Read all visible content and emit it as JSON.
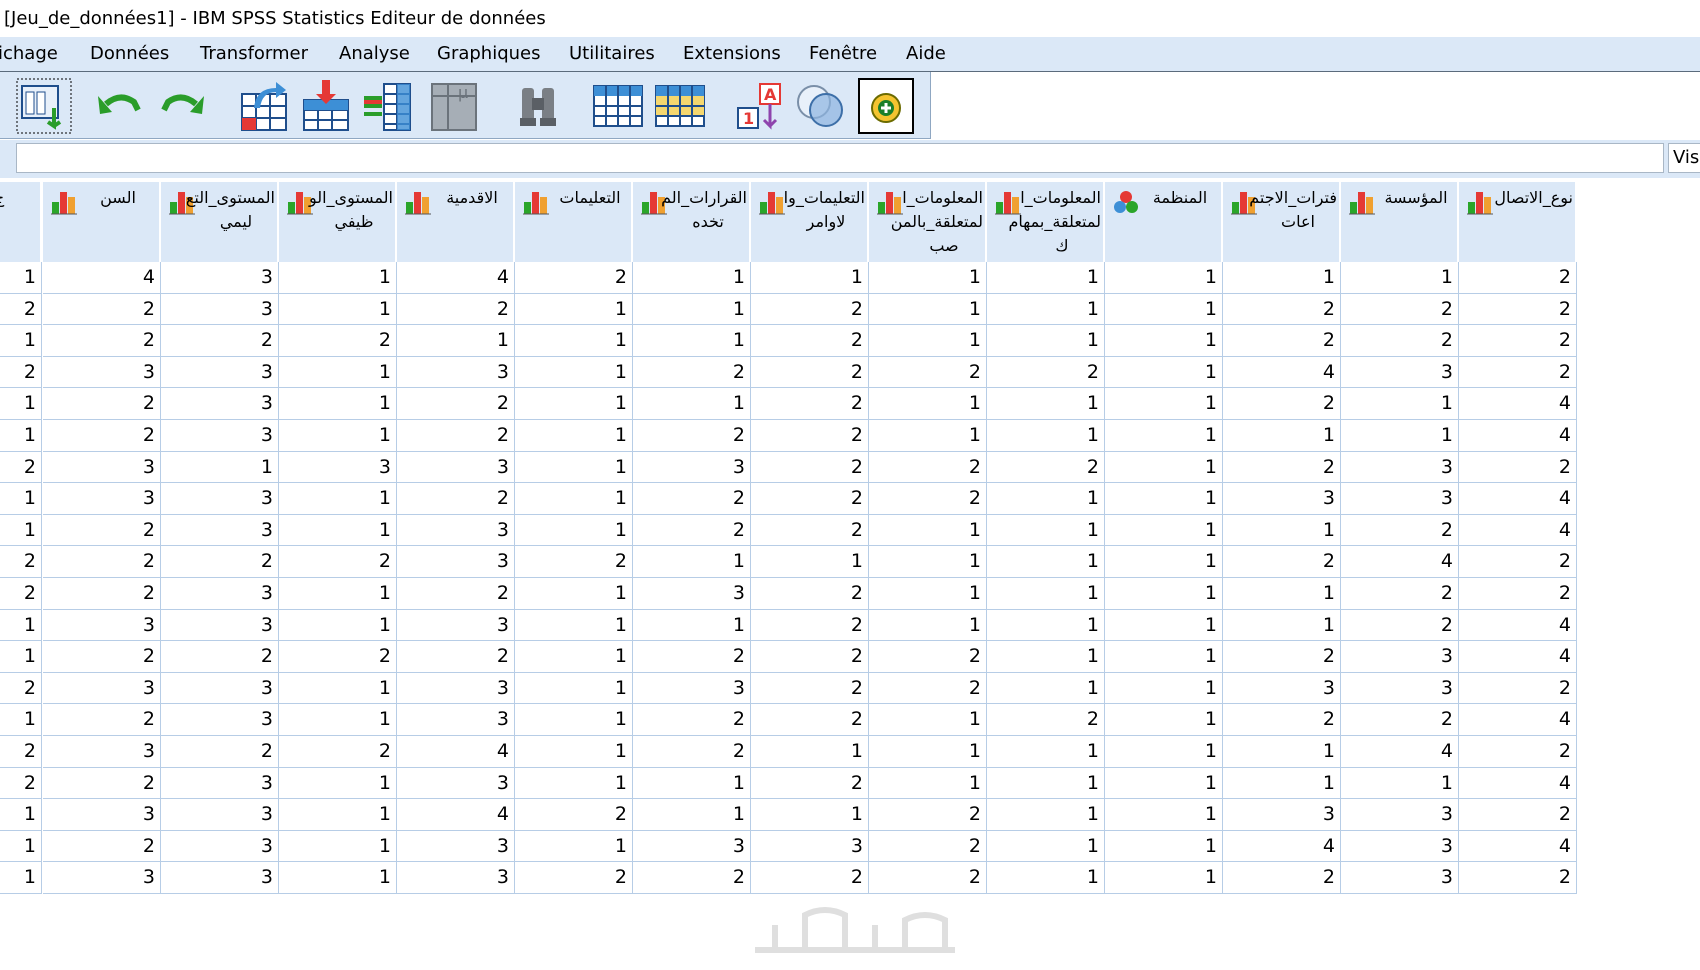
{
  "window": {
    "title": "[Jeu_de_données1] - IBM SPSS Statistics Editeur de données"
  },
  "menu": {
    "items": [
      {
        "id": "view",
        "label": "ichage"
      },
      {
        "id": "data",
        "label": "Données"
      },
      {
        "id": "transform",
        "label": "Transformer"
      },
      {
        "id": "analyze",
        "label": "Analyse"
      },
      {
        "id": "graphs",
        "label": "Graphiques"
      },
      {
        "id": "utilities",
        "label": "Utilitaires"
      },
      {
        "id": "extensions",
        "label": "Extensions"
      },
      {
        "id": "window",
        "label": "Fenêtre"
      },
      {
        "id": "help",
        "label": "Aide"
      }
    ]
  },
  "toolbar": {
    "buttons": [
      {
        "name": "recall-dialog-icon"
      },
      {
        "name": "undo-icon"
      },
      {
        "name": "redo-icon"
      },
      {
        "name": "goto-case-icon"
      },
      {
        "name": "insert-cases-icon"
      },
      {
        "name": "insert-variable-icon"
      },
      {
        "name": "variables-icon"
      },
      {
        "name": "find-icon"
      },
      {
        "name": "split-file-icon"
      },
      {
        "name": "select-cases-icon"
      },
      {
        "name": "value-labels-icon"
      },
      {
        "name": "use-sets-icon"
      },
      {
        "name": "spell-check-icon"
      }
    ]
  },
  "editbar": {
    "cell_value": "",
    "visible_label": "Vis"
  },
  "grid": {
    "columns": [
      {
        "name": "ج",
        "line2": "",
        "icon": "bar"
      },
      {
        "name": "السن",
        "line2": "",
        "icon": "bar"
      },
      {
        "name": "المستوى_التع",
        "line2": "ليمي",
        "icon": "bar"
      },
      {
        "name": "المستوى_الو",
        "line2": "ظيفي",
        "icon": "bar"
      },
      {
        "name": "الاقدمية",
        "line2": "",
        "icon": "bar"
      },
      {
        "name": "التعليمات",
        "line2": "",
        "icon": "bar"
      },
      {
        "name": "القرارات_الم",
        "line2": "تخده",
        "icon": "bar"
      },
      {
        "name": "التعليمات_وا",
        "line2": "لاوامر",
        "icon": "bar"
      },
      {
        "name": "المعلومات_ا",
        "line2": "لمتعلقة_بالمن",
        "line3": "صب",
        "icon": "bar"
      },
      {
        "name": "المعلومات_ا",
        "line2": "لمتعلقة_بمهام",
        "line3": "ك",
        "icon": "bar"
      },
      {
        "name": "المنظمة",
        "line2": "",
        "icon": "nominal"
      },
      {
        "name": "فترات_الاجتم",
        "line2": "اعات",
        "icon": "bar"
      },
      {
        "name": "المؤسسة",
        "line2": "",
        "icon": "bar"
      },
      {
        "name": "نوع_الاتصال",
        "line2": "",
        "icon": "bar"
      }
    ],
    "rows": [
      [
        "1",
        "4",
        "3",
        "1",
        "4",
        "2",
        "1",
        "1",
        "1",
        "1",
        "1",
        "1",
        "1",
        "2"
      ],
      [
        "2",
        "2",
        "3",
        "1",
        "2",
        "1",
        "1",
        "2",
        "1",
        "1",
        "1",
        "2",
        "2",
        "2"
      ],
      [
        "1",
        "2",
        "2",
        "2",
        "1",
        "1",
        "1",
        "2",
        "1",
        "1",
        "1",
        "2",
        "2",
        "2"
      ],
      [
        "2",
        "3",
        "3",
        "1",
        "3",
        "1",
        "2",
        "2",
        "2",
        "2",
        "1",
        "4",
        "3",
        "2"
      ],
      [
        "1",
        "2",
        "3",
        "1",
        "2",
        "1",
        "1",
        "2",
        "1",
        "1",
        "1",
        "2",
        "1",
        "4"
      ],
      [
        "1",
        "2",
        "3",
        "1",
        "2",
        "1",
        "2",
        "2",
        "1",
        "1",
        "1",
        "1",
        "1",
        "4"
      ],
      [
        "2",
        "3",
        "1",
        "3",
        "3",
        "1",
        "3",
        "2",
        "2",
        "2",
        "1",
        "2",
        "3",
        "2"
      ],
      [
        "1",
        "3",
        "3",
        "1",
        "2",
        "1",
        "2",
        "2",
        "2",
        "1",
        "1",
        "3",
        "3",
        "4"
      ],
      [
        "1",
        "2",
        "3",
        "1",
        "3",
        "1",
        "2",
        "2",
        "1",
        "1",
        "1",
        "1",
        "2",
        "4"
      ],
      [
        "2",
        "2",
        "2",
        "2",
        "3",
        "2",
        "1",
        "1",
        "1",
        "1",
        "1",
        "2",
        "4",
        "2"
      ],
      [
        "2",
        "2",
        "3",
        "1",
        "2",
        "1",
        "3",
        "2",
        "1",
        "1",
        "1",
        "1",
        "2",
        "2"
      ],
      [
        "1",
        "3",
        "3",
        "1",
        "3",
        "1",
        "1",
        "2",
        "1",
        "1",
        "1",
        "1",
        "2",
        "4"
      ],
      [
        "1",
        "2",
        "2",
        "2",
        "2",
        "1",
        "2",
        "2",
        "2",
        "1",
        "1",
        "2",
        "3",
        "4"
      ],
      [
        "2",
        "3",
        "3",
        "1",
        "3",
        "1",
        "3",
        "2",
        "2",
        "1",
        "1",
        "3",
        "3",
        "2"
      ],
      [
        "1",
        "2",
        "3",
        "1",
        "3",
        "1",
        "2",
        "2",
        "1",
        "2",
        "1",
        "2",
        "2",
        "4"
      ],
      [
        "2",
        "3",
        "2",
        "2",
        "4",
        "1",
        "2",
        "1",
        "1",
        "1",
        "1",
        "1",
        "4",
        "2"
      ],
      [
        "2",
        "2",
        "3",
        "1",
        "3",
        "1",
        "1",
        "2",
        "1",
        "1",
        "1",
        "1",
        "1",
        "4"
      ],
      [
        "1",
        "3",
        "3",
        "1",
        "4",
        "2",
        "1",
        "1",
        "2",
        "1",
        "1",
        "3",
        "3",
        "2"
      ],
      [
        "1",
        "2",
        "3",
        "1",
        "3",
        "1",
        "3",
        "3",
        "2",
        "1",
        "1",
        "4",
        "3",
        "4"
      ],
      [
        "1",
        "3",
        "3",
        "1",
        "3",
        "2",
        "2",
        "2",
        "2",
        "1",
        "1",
        "2",
        "3",
        "2"
      ]
    ]
  }
}
